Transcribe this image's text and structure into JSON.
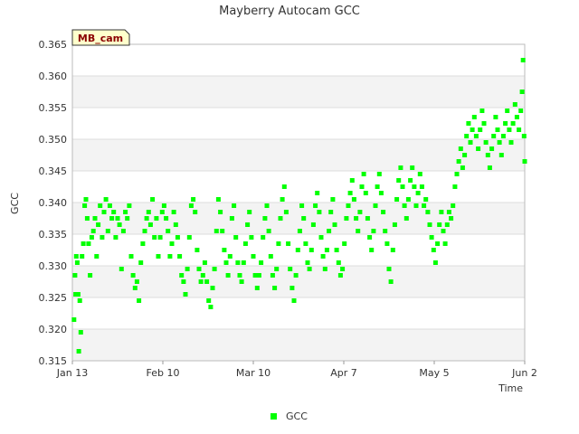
{
  "chart_data": {
    "type": "scatter",
    "title": "Mayberry Autocam GCC",
    "xlabel": "Time",
    "ylabel": "GCC",
    "badge": "MB_cam",
    "ylim": [
      0.315,
      0.365
    ],
    "xlim": [
      "Jan 13",
      "Jun 2"
    ],
    "yticks": [
      "0.315",
      "0.320",
      "0.325",
      "0.330",
      "0.335",
      "0.340",
      "0.345",
      "0.350",
      "0.355",
      "0.360",
      "0.365"
    ],
    "xticks": [
      {
        "label": "Jan 13",
        "day": 0
      },
      {
        "label": "Feb 10",
        "day": 28
      },
      {
        "label": "Mar 10",
        "day": 56
      },
      {
        "label": "Apr 7",
        "day": 84
      },
      {
        "label": "May 5",
        "day": 112
      },
      {
        "label": "Jun 2",
        "day": 140
      }
    ],
    "grid": true,
    "legend_position": "bottom",
    "series": [
      {
        "name": "GCC",
        "color": "#00ff00",
        "points": [
          [
            0.5,
            0.3215
          ],
          [
            0.8,
            0.3285
          ],
          [
            1.0,
            0.3255
          ],
          [
            1.2,
            0.3315
          ],
          [
            1.5,
            0.3305
          ],
          [
            1.8,
            0.3255
          ],
          [
            2.0,
            0.3165
          ],
          [
            2.3,
            0.3245
          ],
          [
            2.6,
            0.3195
          ],
          [
            3.0,
            0.3315
          ],
          [
            3.4,
            0.3335
          ],
          [
            3.8,
            0.3395
          ],
          [
            4.2,
            0.3405
          ],
          [
            4.6,
            0.3375
          ],
          [
            5.0,
            0.3335
          ],
          [
            5.5,
            0.3285
          ],
          [
            6.0,
            0.3345
          ],
          [
            6.5,
            0.3355
          ],
          [
            7.0,
            0.3375
          ],
          [
            7.5,
            0.3315
          ],
          [
            8.0,
            0.3365
          ],
          [
            8.6,
            0.3395
          ],
          [
            9.2,
            0.3345
          ],
          [
            9.8,
            0.3385
          ],
          [
            10.4,
            0.3405
          ],
          [
            11.0,
            0.3355
          ],
          [
            11.6,
            0.3395
          ],
          [
            12.2,
            0.3375
          ],
          [
            12.8,
            0.3385
          ],
          [
            13.4,
            0.3345
          ],
          [
            14.0,
            0.3375
          ],
          [
            14.6,
            0.3365
          ],
          [
            15.2,
            0.3295
          ],
          [
            15.8,
            0.3355
          ],
          [
            16.4,
            0.3385
          ],
          [
            17.0,
            0.3375
          ],
          [
            17.6,
            0.3395
          ],
          [
            18.2,
            0.3315
          ],
          [
            18.8,
            0.3285
          ],
          [
            19.4,
            0.3265
          ],
          [
            20.0,
            0.3275
          ],
          [
            20.6,
            0.3245
          ],
          [
            21.2,
            0.3305
          ],
          [
            21.8,
            0.3335
          ],
          [
            22.4,
            0.3355
          ],
          [
            23.0,
            0.3375
          ],
          [
            23.6,
            0.3385
          ],
          [
            24.2,
            0.3365
          ],
          [
            24.8,
            0.3405
          ],
          [
            25.4,
            0.3345
          ],
          [
            26.0,
            0.3375
          ],
          [
            26.6,
            0.3315
          ],
          [
            27.2,
            0.3345
          ],
          [
            27.8,
            0.3385
          ],
          [
            28.4,
            0.3395
          ],
          [
            29.0,
            0.3375
          ],
          [
            29.6,
            0.3355
          ],
          [
            30.2,
            0.3315
          ],
          [
            30.8,
            0.3335
          ],
          [
            31.4,
            0.3385
          ],
          [
            32.0,
            0.3365
          ],
          [
            32.6,
            0.3345
          ],
          [
            33.2,
            0.3315
          ],
          [
            33.8,
            0.3285
          ],
          [
            34.4,
            0.3275
          ],
          [
            35.0,
            0.3255
          ],
          [
            35.6,
            0.3295
          ],
          [
            36.2,
            0.3345
          ],
          [
            36.8,
            0.3395
          ],
          [
            37.4,
            0.3405
          ],
          [
            38.0,
            0.3385
          ],
          [
            38.6,
            0.3325
          ],
          [
            39.2,
            0.3295
          ],
          [
            39.8,
            0.3275
          ],
          [
            40.4,
            0.3285
          ],
          [
            41.0,
            0.3305
          ],
          [
            41.6,
            0.3275
          ],
          [
            42.2,
            0.3245
          ],
          [
            42.8,
            0.3235
          ],
          [
            43.4,
            0.3265
          ],
          [
            44.0,
            0.3295
          ],
          [
            44.6,
            0.3355
          ],
          [
            45.2,
            0.3405
          ],
          [
            45.8,
            0.3385
          ],
          [
            46.4,
            0.3355
          ],
          [
            47.0,
            0.3325
          ],
          [
            47.6,
            0.3305
          ],
          [
            48.2,
            0.3285
          ],
          [
            48.8,
            0.3315
          ],
          [
            49.4,
            0.3375
          ],
          [
            50.0,
            0.3395
          ],
          [
            50.6,
            0.3345
          ],
          [
            51.2,
            0.3305
          ],
          [
            51.8,
            0.3285
          ],
          [
            52.4,
            0.3275
          ],
          [
            53.0,
            0.3305
          ],
          [
            53.6,
            0.3335
          ],
          [
            54.2,
            0.3365
          ],
          [
            54.8,
            0.3385
          ],
          [
            55.4,
            0.3345
          ],
          [
            56.0,
            0.3315
          ],
          [
            56.6,
            0.3285
          ],
          [
            57.2,
            0.3265
          ],
          [
            57.8,
            0.3285
          ],
          [
            58.4,
            0.3305
          ],
          [
            59.0,
            0.3345
          ],
          [
            59.6,
            0.3375
          ],
          [
            60.2,
            0.3395
          ],
          [
            60.8,
            0.3355
          ],
          [
            61.4,
            0.3315
          ],
          [
            62.0,
            0.3285
          ],
          [
            62.6,
            0.3265
          ],
          [
            63.2,
            0.3295
          ],
          [
            63.8,
            0.3335
          ],
          [
            64.4,
            0.3375
          ],
          [
            65.0,
            0.3405
          ],
          [
            65.6,
            0.3425
          ],
          [
            66.2,
            0.3385
          ],
          [
            66.8,
            0.3335
          ],
          [
            67.4,
            0.3295
          ],
          [
            68.0,
            0.3265
          ],
          [
            68.6,
            0.3245
          ],
          [
            69.2,
            0.3285
          ],
          [
            69.8,
            0.3325
          ],
          [
            70.4,
            0.3355
          ],
          [
            71.0,
            0.3395
          ],
          [
            71.6,
            0.3375
          ],
          [
            72.2,
            0.3335
          ],
          [
            72.8,
            0.3305
          ],
          [
            73.4,
            0.3295
          ],
          [
            74.0,
            0.3325
          ],
          [
            74.6,
            0.3365
          ],
          [
            75.2,
            0.3395
          ],
          [
            75.8,
            0.3415
          ],
          [
            76.4,
            0.3385
          ],
          [
            77.0,
            0.3345
          ],
          [
            77.6,
            0.3315
          ],
          [
            78.2,
            0.3295
          ],
          [
            78.8,
            0.3325
          ],
          [
            79.4,
            0.3355
          ],
          [
            80.0,
            0.3385
          ],
          [
            80.6,
            0.3405
          ],
          [
            81.2,
            0.3365
          ],
          [
            81.8,
            0.3325
          ],
          [
            82.4,
            0.3305
          ],
          [
            83.0,
            0.3285
          ],
          [
            83.6,
            0.3295
          ],
          [
            84.2,
            0.3335
          ],
          [
            84.8,
            0.3375
          ],
          [
            85.4,
            0.3395
          ],
          [
            86.0,
            0.3415
          ],
          [
            86.6,
            0.3435
          ],
          [
            87.2,
            0.3405
          ],
          [
            87.8,
            0.3375
          ],
          [
            88.4,
            0.3355
          ],
          [
            89.0,
            0.3385
          ],
          [
            89.6,
            0.3425
          ],
          [
            90.2,
            0.3445
          ],
          [
            90.8,
            0.3415
          ],
          [
            91.4,
            0.3375
          ],
          [
            92.0,
            0.3345
          ],
          [
            92.6,
            0.3325
          ],
          [
            93.2,
            0.3355
          ],
          [
            93.8,
            0.3395
          ],
          [
            94.4,
            0.3425
          ],
          [
            95.0,
            0.3445
          ],
          [
            95.6,
            0.3415
          ],
          [
            96.2,
            0.3385
          ],
          [
            96.8,
            0.3355
          ],
          [
            97.4,
            0.3335
          ],
          [
            98.0,
            0.3295
          ],
          [
            98.6,
            0.3275
          ],
          [
            99.2,
            0.3325
          ],
          [
            99.8,
            0.3365
          ],
          [
            100.4,
            0.3405
          ],
          [
            101.0,
            0.3435
          ],
          [
            101.6,
            0.3455
          ],
          [
            102.2,
            0.3425
          ],
          [
            102.8,
            0.3395
          ],
          [
            103.4,
            0.3375
          ],
          [
            104.0,
            0.3405
          ],
          [
            104.6,
            0.3435
          ],
          [
            105.2,
            0.3455
          ],
          [
            105.8,
            0.3425
          ],
          [
            106.4,
            0.3395
          ],
          [
            107.0,
            0.3415
          ],
          [
            107.6,
            0.3445
          ],
          [
            108.2,
            0.3425
          ],
          [
            108.8,
            0.3395
          ],
          [
            109.4,
            0.3405
          ],
          [
            110.0,
            0.3385
          ],
          [
            110.6,
            0.3365
          ],
          [
            111.2,
            0.3345
          ],
          [
            111.8,
            0.3325
          ],
          [
            112.4,
            0.3305
          ],
          [
            113.0,
            0.3335
          ],
          [
            113.6,
            0.3365
          ],
          [
            114.2,
            0.3385
          ],
          [
            114.8,
            0.3355
          ],
          [
            115.4,
            0.3335
          ],
          [
            116.0,
            0.3365
          ],
          [
            116.6,
            0.3385
          ],
          [
            117.2,
            0.3375
          ],
          [
            117.8,
            0.3395
          ],
          [
            118.4,
            0.3425
          ],
          [
            119.0,
            0.3445
          ],
          [
            119.6,
            0.3465
          ],
          [
            120.2,
            0.3485
          ],
          [
            120.8,
            0.3455
          ],
          [
            121.4,
            0.3475
          ],
          [
            122.0,
            0.3505
          ],
          [
            122.6,
            0.3525
          ],
          [
            123.2,
            0.3495
          ],
          [
            123.8,
            0.3515
          ],
          [
            124.4,
            0.3535
          ],
          [
            125.0,
            0.3505
          ],
          [
            125.6,
            0.3485
          ],
          [
            126.2,
            0.3515
          ],
          [
            126.8,
            0.3545
          ],
          [
            127.4,
            0.3525
          ],
          [
            128.0,
            0.3495
          ],
          [
            128.6,
            0.3475
          ],
          [
            129.2,
            0.3455
          ],
          [
            129.8,
            0.3485
          ],
          [
            130.4,
            0.3505
          ],
          [
            131.0,
            0.3535
          ],
          [
            131.6,
            0.3515
          ],
          [
            132.2,
            0.3495
          ],
          [
            132.8,
            0.3475
          ],
          [
            133.4,
            0.3505
          ],
          [
            134.0,
            0.3525
          ],
          [
            134.6,
            0.3545
          ],
          [
            135.2,
            0.3515
          ],
          [
            135.8,
            0.3495
          ],
          [
            136.4,
            0.3525
          ],
          [
            137.0,
            0.3555
          ],
          [
            137.6,
            0.3535
          ],
          [
            138.2,
            0.3515
          ],
          [
            138.8,
            0.3545
          ],
          [
            139.2,
            0.3575
          ],
          [
            139.5,
            0.3625
          ],
          [
            139.8,
            0.3505
          ],
          [
            140.0,
            0.3465
          ]
        ]
      }
    ]
  }
}
